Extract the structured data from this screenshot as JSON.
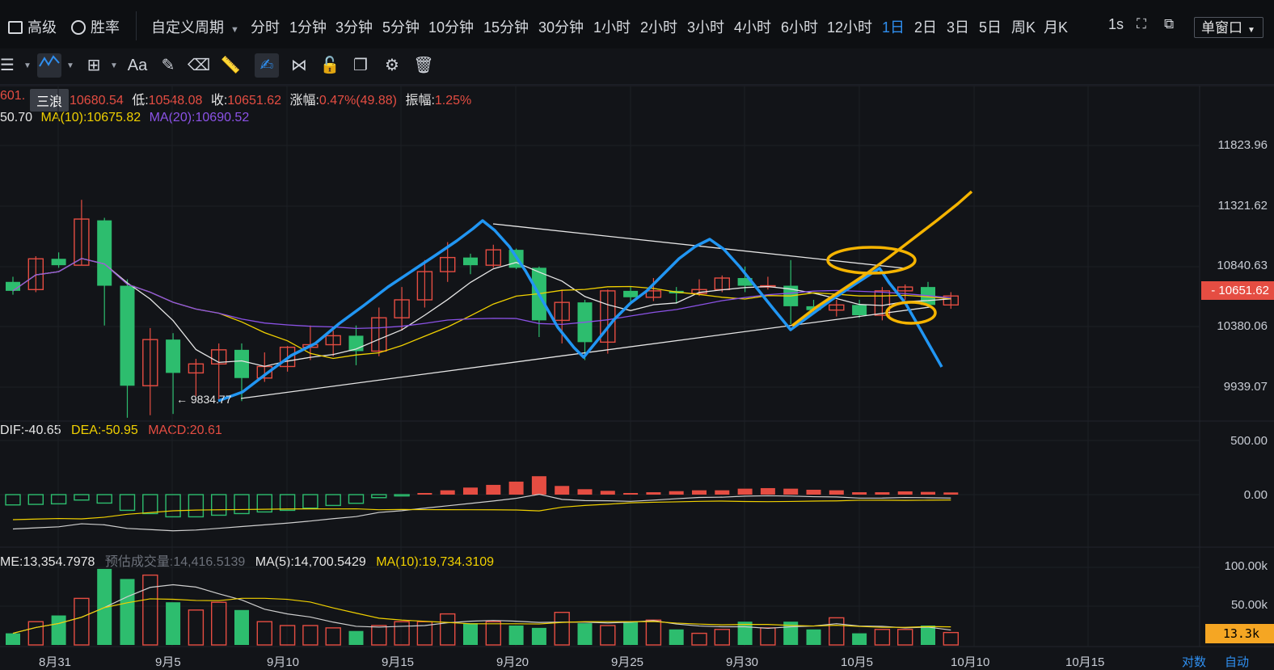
{
  "topbar": {
    "advanced_label": "高级",
    "winrate_label": "胜率",
    "custom_period_label": "自定义周期",
    "periods": [
      "分时",
      "1分钟",
      "3分钟",
      "5分钟",
      "10分钟",
      "15分钟",
      "30分钟",
      "1小时",
      "2小时",
      "3小时",
      "4小时",
      "6小时",
      "12小时",
      "1日",
      "2日",
      "3日",
      "5日",
      "周K",
      "月K"
    ],
    "active_period": "1日",
    "refresh_label": "1s",
    "window_mode_label": "单窗口"
  },
  "toolbar": {
    "text_tool_label": "Aa",
    "tooltip_label": "三浪",
    "icons": [
      "menu-icon",
      "wave-tool-icon",
      "layout-icon",
      "text-icon",
      "brush-icon",
      "eraser-icon",
      "ruler-icon",
      "draw-mode-icon",
      "pattern-icon",
      "lock-icon",
      "copy-icon",
      "settings-icon",
      "delete-icon"
    ]
  },
  "price_info": {
    "open_partial": "601.",
    "high_value": "10680.54",
    "low_label": "低:",
    "low_value": "10548.08",
    "close_label": "收:",
    "close_value": "10651.62",
    "change_label": "涨幅:",
    "change_value": "0.47%(49.88)",
    "amp_label": "振幅:",
    "amp_value": "1.25%",
    "ma5_partial": "50.70",
    "ma10_label": "MA(10):10675.82",
    "ma20_label": "MA(20):10690.52"
  },
  "price_axis": [
    "11823.96",
    "11321.62",
    "10840.63",
    "10380.06",
    "9939.07"
  ],
  "last_price": "10651.62",
  "low_marker": "← 9834.77",
  "macd": {
    "dif": "DIF:-40.65",
    "dea": "DEA:-50.95",
    "macd": "MACD:20.61",
    "axis": [
      "500.00",
      "0.00"
    ]
  },
  "volume": {
    "vol": "ME:13,354.7978",
    "est_label": "预估成交量:",
    "est_value": "14,416.5139",
    "ma5": "MA(5):14,700.5429",
    "ma10": "MA(10):19,734.3109",
    "axis": [
      "100.00k",
      "50.00k"
    ],
    "current": "13.3k"
  },
  "x_axis": [
    "8月31",
    "9月5",
    "9月10",
    "9月15",
    "9月20",
    "9月25",
    "9月30",
    "10月5",
    "10月10",
    "10月15"
  ],
  "footer_right": [
    "对数",
    "自动"
  ],
  "colors": {
    "up": "#e54d42",
    "down": "#2dbd6e",
    "ma5": "#e6e6e6",
    "ma10": "#f0d000",
    "ma20": "#8b52e6",
    "accent": "#2f8ff0",
    "drawing_blue": "#2196f3",
    "drawing_orange": "#f5b400"
  },
  "chart_data": {
    "type": "candlestick",
    "candles": [
      {
        "o": 10760,
        "c": 10690,
        "h": 10800,
        "l": 10660
      },
      {
        "o": 10700,
        "c": 10940,
        "h": 10960,
        "l": 10680
      },
      {
        "o": 10940,
        "c": 10890,
        "h": 10990,
        "l": 10870
      },
      {
        "o": 10890,
        "c": 11250,
        "h": 11400,
        "l": 10890
      },
      {
        "o": 11240,
        "c": 10730,
        "h": 11260,
        "l": 10420
      },
      {
        "o": 10730,
        "c": 9950,
        "h": 10780,
        "l": 9700
      },
      {
        "o": 9950,
        "c": 10310,
        "h": 10400,
        "l": 9720
      },
      {
        "o": 10310,
        "c": 10050,
        "h": 10360,
        "l": 9730
      },
      {
        "o": 10050,
        "c": 10120,
        "h": 10160,
        "l": 9870
      },
      {
        "o": 10120,
        "c": 10230,
        "h": 10280,
        "l": 9830
      },
      {
        "o": 10230,
        "c": 10010,
        "h": 10280,
        "l": 9830
      },
      {
        "o": 10010,
        "c": 10100,
        "h": 10210,
        "l": 9980
      },
      {
        "o": 10100,
        "c": 10250,
        "h": 10260,
        "l": 10060
      },
      {
        "o": 10250,
        "c": 10270,
        "h": 10420,
        "l": 10150
      },
      {
        "o": 10270,
        "c": 10340,
        "h": 10380,
        "l": 10180
      },
      {
        "o": 10340,
        "c": 10220,
        "h": 10420,
        "l": 10110
      },
      {
        "o": 10220,
        "c": 10480,
        "h": 10560,
        "l": 10180
      },
      {
        "o": 10480,
        "c": 10620,
        "h": 10720,
        "l": 10380
      },
      {
        "o": 10620,
        "c": 10840,
        "h": 10930,
        "l": 10560
      },
      {
        "o": 10840,
        "c": 10950,
        "h": 11070,
        "l": 10760
      },
      {
        "o": 10950,
        "c": 10890,
        "h": 10980,
        "l": 10820
      },
      {
        "o": 10890,
        "c": 11010,
        "h": 11050,
        "l": 10870
      },
      {
        "o": 11010,
        "c": 10870,
        "h": 11020,
        "l": 10860
      },
      {
        "o": 10870,
        "c": 10460,
        "h": 10880,
        "l": 10330
      },
      {
        "o": 10460,
        "c": 10600,
        "h": 10700,
        "l": 10280
      },
      {
        "o": 10600,
        "c": 10290,
        "h": 10620,
        "l": 10150
      },
      {
        "o": 10290,
        "c": 10690,
        "h": 10700,
        "l": 10200
      },
      {
        "o": 10690,
        "c": 10640,
        "h": 10720,
        "l": 10600
      },
      {
        "o": 10640,
        "c": 10690,
        "h": 10790,
        "l": 10610
      },
      {
        "o": 10690,
        "c": 10670,
        "h": 10720,
        "l": 10590
      },
      {
        "o": 10670,
        "c": 10700,
        "h": 10780,
        "l": 10650
      },
      {
        "o": 10700,
        "c": 10790,
        "h": 10810,
        "l": 10680
      },
      {
        "o": 10790,
        "c": 10730,
        "h": 10880,
        "l": 10680
      },
      {
        "o": 10730,
        "c": 10730,
        "h": 10800,
        "l": 10700
      },
      {
        "o": 10730,
        "c": 10570,
        "h": 10930,
        "l": 10430
      },
      {
        "o": 10570,
        "c": 10540,
        "h": 10620,
        "l": 10510
      },
      {
        "o": 10540,
        "c": 10580,
        "h": 10620,
        "l": 10490
      },
      {
        "o": 10580,
        "c": 10500,
        "h": 10620,
        "l": 10480
      },
      {
        "o": 10500,
        "c": 10690,
        "h": 10720,
        "l": 10460
      },
      {
        "o": 10690,
        "c": 10720,
        "h": 10740,
        "l": 10620
      },
      {
        "o": 10720,
        "c": 10580,
        "h": 10760,
        "l": 10560
      },
      {
        "o": 10580,
        "c": 10650,
        "h": 10680,
        "l": 10550
      }
    ],
    "macd_hist": [
      -95,
      -90,
      -85,
      -50,
      -78,
      -145,
      -175,
      -205,
      -205,
      -190,
      -175,
      -160,
      -145,
      -125,
      -100,
      -80,
      -28,
      -12,
      15,
      40,
      65,
      90,
      120,
      170,
      80,
      50,
      35,
      15,
      22,
      32,
      40,
      40,
      55,
      60,
      55,
      45,
      40,
      22,
      22,
      30,
      25,
      20
    ],
    "volume": [
      15,
      30,
      38,
      60,
      98,
      85,
      90,
      55,
      45,
      55,
      45,
      30,
      25,
      25,
      22,
      18,
      25,
      30,
      30,
      40,
      28,
      30,
      25,
      22,
      42,
      28,
      25,
      30,
      32,
      20,
      15,
      20,
      30,
      22,
      30,
      20,
      35,
      15,
      20,
      20,
      25,
      16
    ]
  }
}
